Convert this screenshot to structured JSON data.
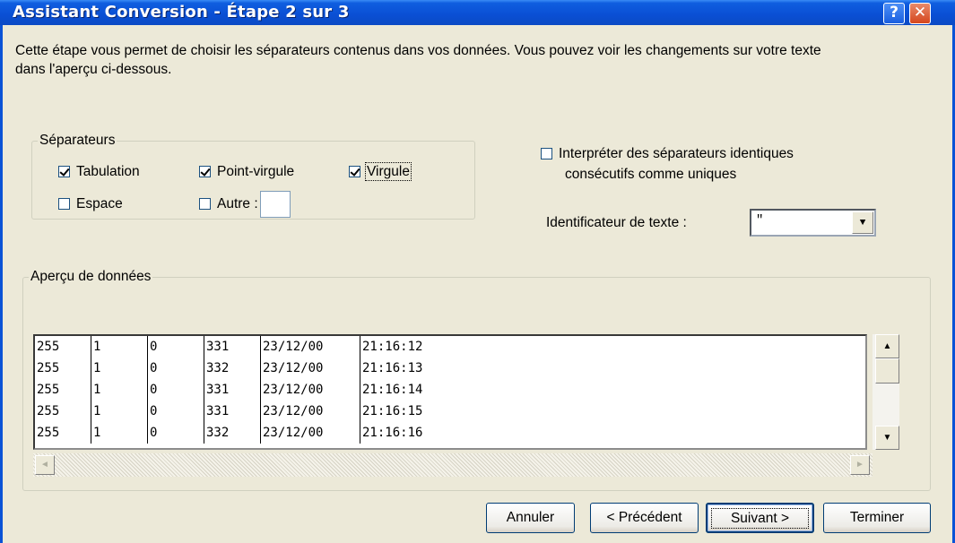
{
  "window": {
    "title": "Assistant Conversion - Étape 2 sur 3",
    "help_label": "?",
    "close_label": "✕"
  },
  "description": "Cette étape vous permet de choisir les séparateurs contenus dans vos données. Vous pouvez voir les changements sur votre texte dans l'aperçu ci-dessous.",
  "separators": {
    "legend": "Séparateurs",
    "tabulation": {
      "label": "Tabulation",
      "checked": true
    },
    "point_virgule": {
      "label": "Point-virgule",
      "checked": true
    },
    "virgule": {
      "label": "Virgule",
      "checked": true
    },
    "espace": {
      "label": "Espace",
      "checked": false
    },
    "autre": {
      "label": "Autre :",
      "checked": false,
      "value": ""
    }
  },
  "consecutive": {
    "label_line1": "Interpréter des séparateurs identiques",
    "label_line2": "consécutifs comme uniques",
    "checked": false
  },
  "text_qualifier": {
    "label": "Identificateur de texte :",
    "value": "\""
  },
  "preview": {
    "legend": "Aperçu de données",
    "rows": [
      [
        "255",
        "1",
        "0",
        "331",
        "23/12/00",
        "21:16:12"
      ],
      [
        "255",
        "1",
        "0",
        "332",
        "23/12/00",
        "21:16:13"
      ],
      [
        "255",
        "1",
        "0",
        "331",
        "23/12/00",
        "21:16:14"
      ],
      [
        "255",
        "1",
        "0",
        "331",
        "23/12/00",
        "21:16:15"
      ],
      [
        "255",
        "1",
        "0",
        "332",
        "23/12/00",
        "21:16:16"
      ]
    ]
  },
  "buttons": {
    "cancel": "Annuler",
    "previous": "< Précédent",
    "next": "Suivant >",
    "finish": "Terminer"
  },
  "icons": {
    "scroll_up": "▲",
    "scroll_down": "▼",
    "scroll_left": "◄",
    "scroll_right": "►",
    "dropdown": "▼"
  },
  "colors": {
    "titlebar": "#0a4fd4",
    "dialog_bg": "#ece9d8",
    "close": "#d5461d"
  }
}
